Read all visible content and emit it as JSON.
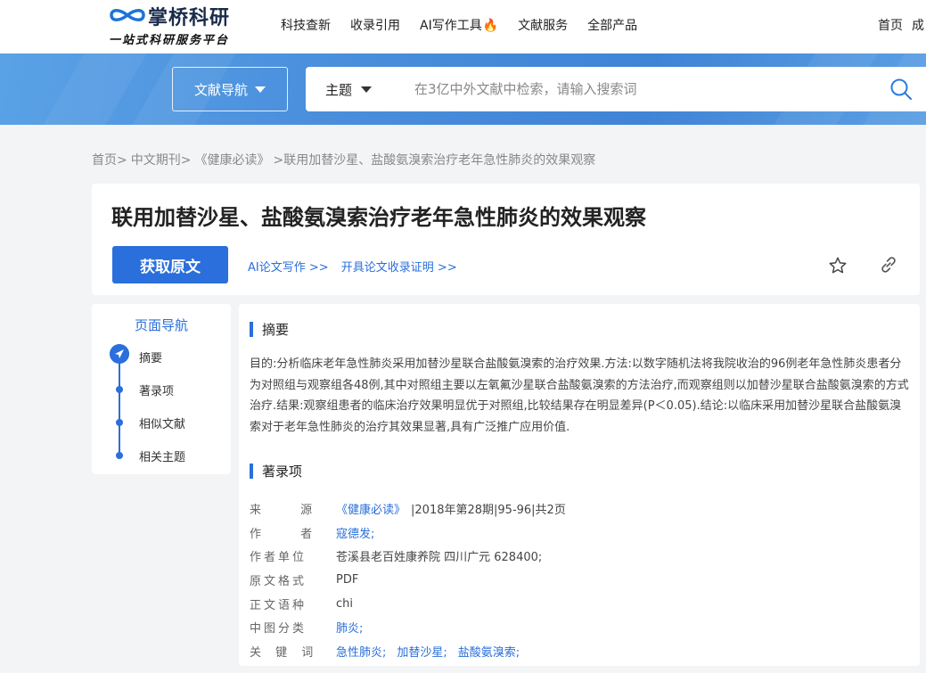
{
  "header": {
    "brand_name": "掌桥科研",
    "brand_slogan": "一站式科研服务平台",
    "nav": [
      "科技查新",
      "收录引用",
      "AI写作工具",
      "文献服务",
      "全部产品"
    ],
    "links": [
      "首页",
      "成"
    ]
  },
  "search": {
    "nav_dropdown_label": "文献导航",
    "scope_label": "主题",
    "placeholder": "在3亿中外文献中检索，请输入搜索词"
  },
  "breadcrumb": {
    "items": [
      "首页>",
      "中文期刊>",
      "《健康必读》",
      ">联用加替沙星、盐酸氨溴索治疗老年急性肺炎的效果观察"
    ]
  },
  "article": {
    "title": "联用加替沙星、盐酸氨溴索治疗老年急性肺炎的效果观察",
    "get_fulltext_label": "获取原文",
    "link_ai_writing": "AI论文写作 >>",
    "link_certificate": "开具论文收录证明 >>"
  },
  "page_nav": {
    "title": "页面导航",
    "items": [
      "摘要",
      "著录项",
      "相似文献",
      "相关主题"
    ]
  },
  "abstract": {
    "heading": "摘要",
    "text": "目的:分析临床老年急性肺炎采用加替沙星联合盐酸氨溴索的治疗效果.方法:以数字随机法将我院收治的96例老年急性肺炎患者分为对照组与观察组各48例,其中对照组主要以左氧氟沙星联合盐酸氨溴索的方法治疗,而观察组则以加替沙星联合盐酸氨溴索的方式治疗.结果:观察组患者的临床治疗效果明显优于对照组,比较结果存在明显差异(P＜0.05).结论:以临床采用加替沙星联合盐酸氨溴索对于老年急性肺炎的治疗其效果显著,具有广泛推广应用价值."
  },
  "bibliography": {
    "heading": "著录项",
    "source_label": "来 源",
    "source_journal": "《健康必读》",
    "source_issue": "|2018年第28期|95-96|共2页",
    "author_label": "作 者",
    "author": "寇德发;",
    "unit_label": "作者单位",
    "unit": "苍溪县老百姓康养院 四川广元 628400;",
    "format_label": "原文格式",
    "format": "PDF",
    "lang_label": "正文语种",
    "lang": "chi",
    "clc_label": "中图分类",
    "clc": "肺炎;",
    "keywords_label": "关 键 词",
    "keywords": [
      "急性肺炎;",
      "加替沙星;",
      "盐酸氨溴索;"
    ]
  },
  "colors": {
    "accent": "#2a6fdb",
    "banner": "#4a8fdc",
    "fire": "#ff5a1f"
  },
  "icons": [
    "logo-mark-icon",
    "fire-icon",
    "caret-down-icon",
    "search-icon",
    "star-icon",
    "link-icon",
    "nav-active-icon"
  ]
}
